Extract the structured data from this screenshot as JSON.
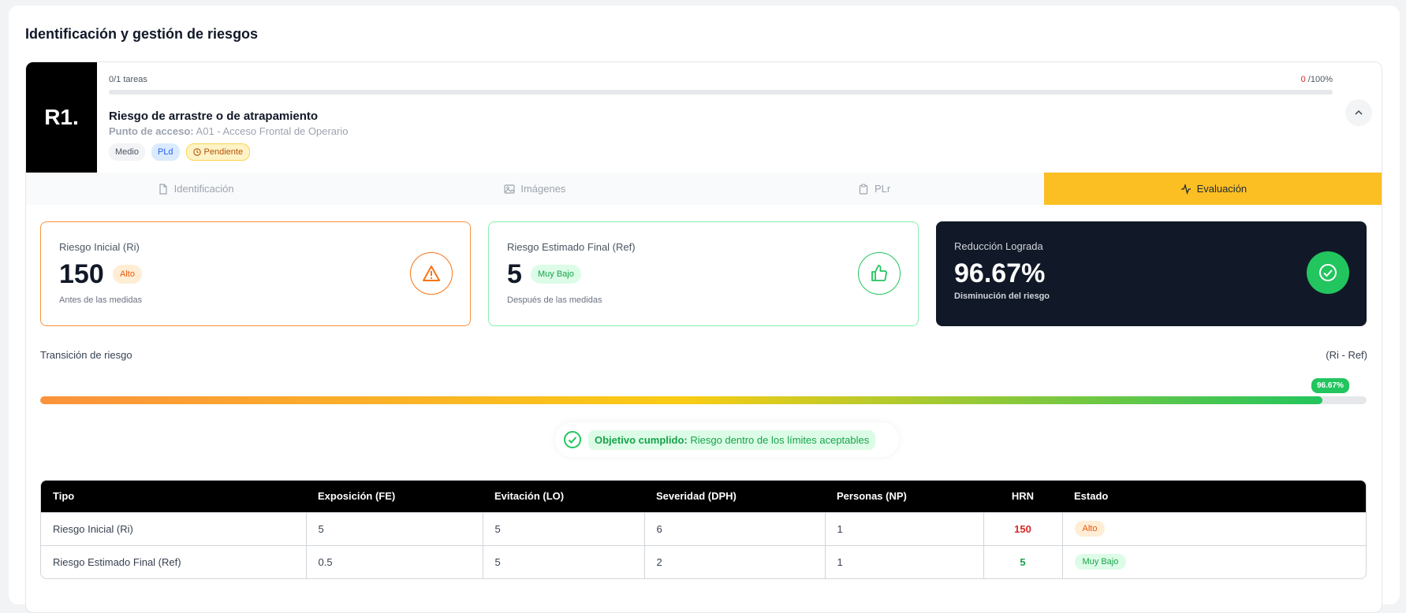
{
  "page": {
    "title": "Identificación y gestión de riesgos"
  },
  "risk": {
    "code": "R1.",
    "tasks": "0/1 tareas",
    "progress_value": "0",
    "progress_total": "/100%",
    "progress_fraction": 0,
    "title": "Riesgo de arrastre o de atrapamiento",
    "access_label": "Punto de acceso:",
    "access_value": "A01 - Acceso Frontal de Operario",
    "tags": {
      "level": "Medio",
      "pl": "PLd",
      "status": "Pendiente"
    }
  },
  "tabs": {
    "identificacion": "Identificación",
    "imagenes": "Imágenes",
    "plr": "PLr",
    "evaluacion": "Evaluación"
  },
  "stats": {
    "initial": {
      "label": "Riesgo Inicial (Ri)",
      "value": "150",
      "badge": "Alto",
      "sub": "Antes de las medidas"
    },
    "final": {
      "label": "Riesgo Estimado Final (Ref)",
      "value": "5",
      "badge": "Muy Bajo",
      "sub": "Después de las medidas"
    },
    "reduction": {
      "label": "Reducción Lograda",
      "value": "96.67%",
      "sub": "Disminución del riesgo"
    }
  },
  "transition": {
    "label": "Transición de riesgo",
    "formula": "(Ri - Ref)",
    "bubble": "96.67%",
    "fill_fraction": 0.9667
  },
  "goal": {
    "bold": "Objetivo cumplido:",
    "text": " Riesgo dentro de los límites aceptables"
  },
  "table": {
    "headers": [
      "Tipo",
      "Exposición (FE)",
      "Evitación (LO)",
      "Severidad (DPH)",
      "Personas (NP)",
      "HRN",
      "Estado"
    ],
    "rows": [
      {
        "tipo": "Riesgo Inicial (Ri)",
        "fe": "5",
        "lo": "5",
        "dph": "6",
        "np": "1",
        "hrn": "150",
        "estado": "Alto"
      },
      {
        "tipo": "Riesgo Estimado Final (Ref)",
        "fe": "0.5",
        "lo": "5",
        "dph": "2",
        "np": "1",
        "hrn": "5",
        "estado": "Muy Bajo"
      }
    ]
  },
  "colors": {
    "accent": "#fbbf24",
    "dark": "#111827",
    "success": "#22c55e",
    "warning": "#f97316"
  }
}
